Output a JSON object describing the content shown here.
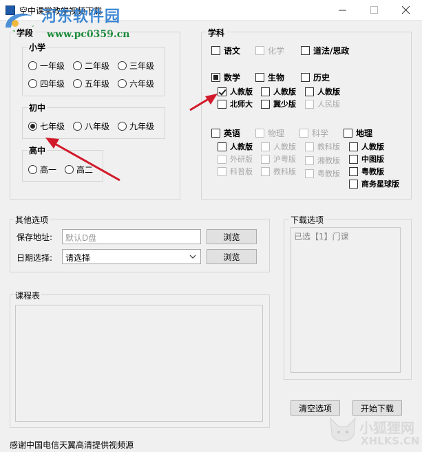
{
  "window": {
    "title": "空中课堂教学视频下载"
  },
  "watermark": {
    "site_name": "河东软件园",
    "site_url": "www.pc0359.cn",
    "fox_name": "小狐狸网",
    "fox_url": "XHLKS.CN"
  },
  "stage": {
    "title": "学段",
    "primary": {
      "title": "小学",
      "grades": [
        "一年级",
        "二年级",
        "三年级",
        "四年级",
        "五年级",
        "六年级"
      ]
    },
    "junior": {
      "title": "初中",
      "grades": [
        "七年级",
        "八年级",
        "九年级"
      ],
      "selected": "七年级"
    },
    "senior": {
      "title": "高中",
      "grades": [
        "高一",
        "高二"
      ]
    }
  },
  "subjects": {
    "title": "学科",
    "chinese": "语文",
    "chemistry": "化学",
    "ethics": "道法/思政",
    "math": "数学",
    "biology": "生物",
    "history": "历史",
    "math_versions": [
      "人教版",
      "北师大"
    ],
    "bio_versions": [
      "人教版",
      "冀少版"
    ],
    "history_versions": [
      "人教版",
      "人民版"
    ],
    "english": "英语",
    "physics": "物理",
    "science": "科学",
    "geography": "地理",
    "english_versions": [
      "人教版",
      "外研版",
      "科普版"
    ],
    "physics_versions": [
      "人教版",
      "沪粤版",
      "教科版"
    ],
    "science_versions": [
      "教科版",
      "湘教版",
      "粤教版"
    ],
    "geo_versions": [
      "人教版",
      "中图版",
      "粤教版",
      "商务星球版"
    ]
  },
  "other": {
    "title": "其他选项",
    "save_label": "保存地址:",
    "save_placeholder": "默认D盘",
    "browse_label": "浏览",
    "date_label": "日期选择:",
    "date_value": "请选择"
  },
  "download": {
    "title": "下载选项",
    "summary": "已选【1】门课"
  },
  "schedule": {
    "title": "课程表"
  },
  "buttons": {
    "clear": "清空选项",
    "start": "开始下载"
  },
  "footer": {
    "text": "感谢中国电信天翼高清提供视频源"
  },
  "colors": {
    "arrow": "#d11a2a",
    "watermark_blue": "#2f7fd0",
    "watermark_green": "#1a8a3a"
  }
}
